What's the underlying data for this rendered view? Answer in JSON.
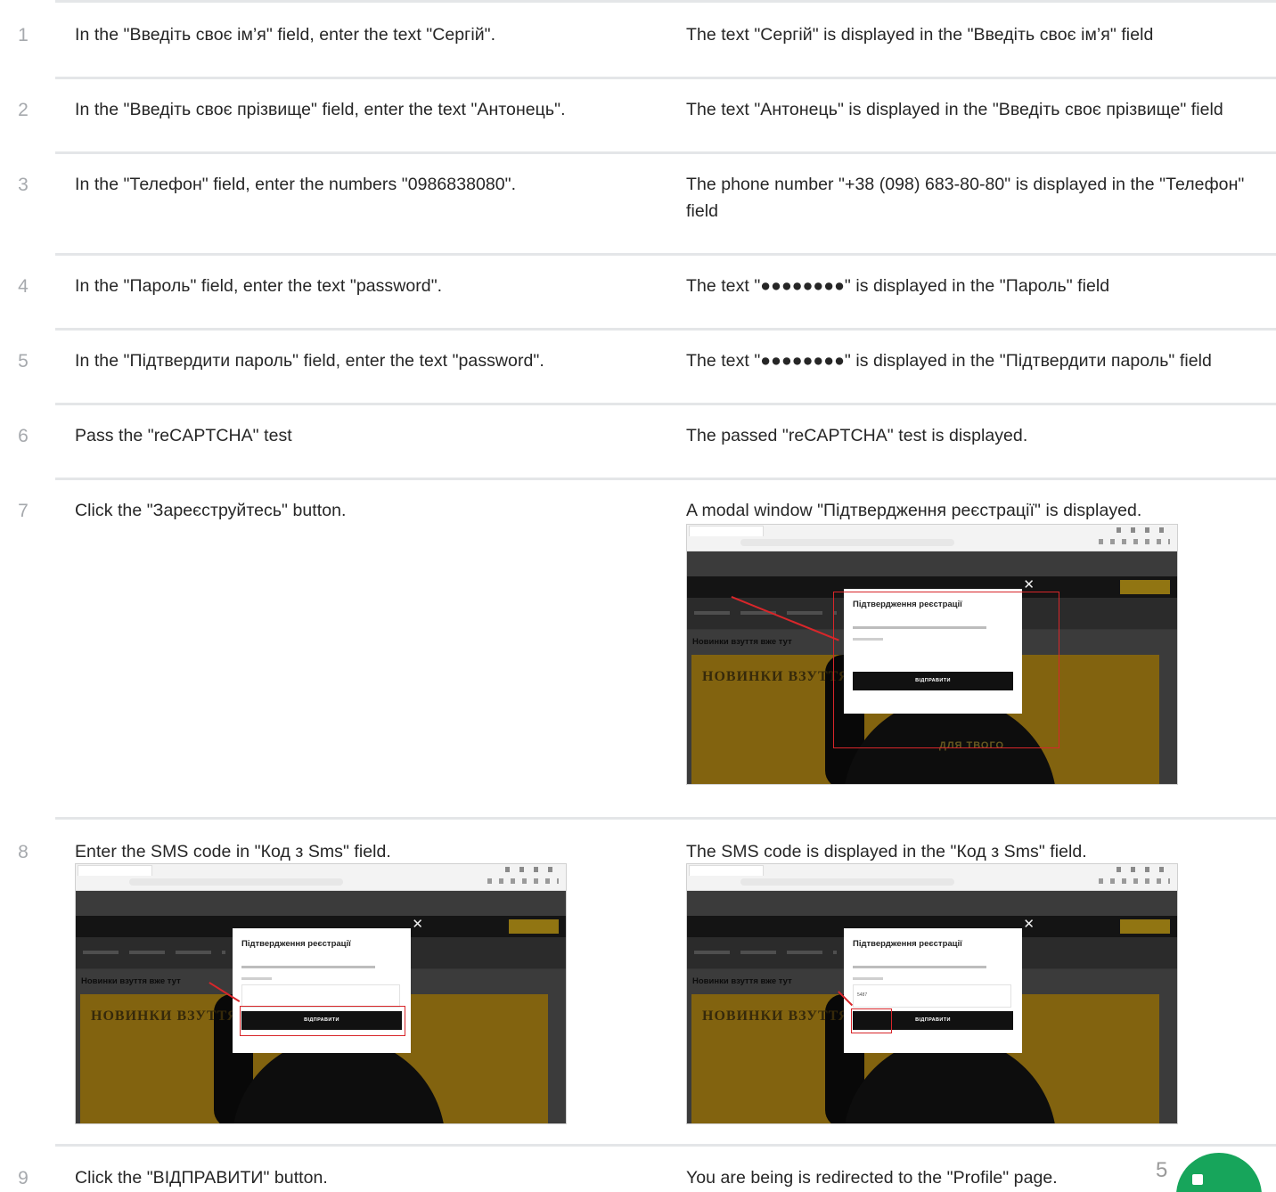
{
  "steps": [
    {
      "num": "1",
      "action": "In the \"Введіть своє ім’я\" field, enter the text \"Сергій\".",
      "result": "The text \"Сергій\" is displayed in the \"Введіть своє ім’я\" field"
    },
    {
      "num": "2",
      "action": "In the \"Введіть своє прізвище\" field, enter the text \"Антонець\".",
      "result": "The text \"Антонець\" is displayed in the \"Введіть своє прізвище\" field"
    },
    {
      "num": "3",
      "action": "In the \"Телефон\" field, enter the numbers \"0986838080\".",
      "result": "The phone number \"+38 (098) 683-80-80\" is displayed in the \"Телефон\" field"
    },
    {
      "num": "4",
      "action": "In the \"Пароль\" field, enter the text \"password\".",
      "result": "The text \"●●●●●●●●\" is displayed in the \"Пароль\" field"
    },
    {
      "num": "5",
      "action": "In the \"Підтвердити пароль\" field, enter the text \"password\".",
      "result": "The text \"●●●●●●●●\" is displayed in the \"Підтвердити пароль\" field"
    },
    {
      "num": "6",
      "action": "Pass the \"reCAPTCHA\" test",
      "result": "The passed \"reCAPTCHA\" test is displayed."
    },
    {
      "num": "7",
      "action": "Click the \"Зареєструйтесь\" button.",
      "result": "A modal window \"Підтвердження реєстрації\" is displayed."
    },
    {
      "num": "8",
      "action": "Enter the SMS code in  \"Код з Sms\" field.",
      "result": "The SMS code is displayed in the \"Код з Sms\" field."
    },
    {
      "num": "9",
      "action": "Click the \"ВІДПРАВИТИ\" button.",
      "result": "You are being is redirected to the \"Profile\" page."
    }
  ],
  "screenshot": {
    "section_heading": "Новинки взуття вже тут",
    "banner_word": "НОВИНКИ ВЗУТТЯ",
    "banner_slogan": "ДЛЯ ТВОГО",
    "modal_title": "Підтвердження реєстрації",
    "modal_button": "ВІДПРАВИТИ",
    "sms_value": "5487",
    "highlight_color": "#d8262a"
  },
  "page_number": "5",
  "colors": {
    "fab": "#17a55b",
    "rule": "#e4e6e8",
    "number": "#a6a9ad"
  }
}
